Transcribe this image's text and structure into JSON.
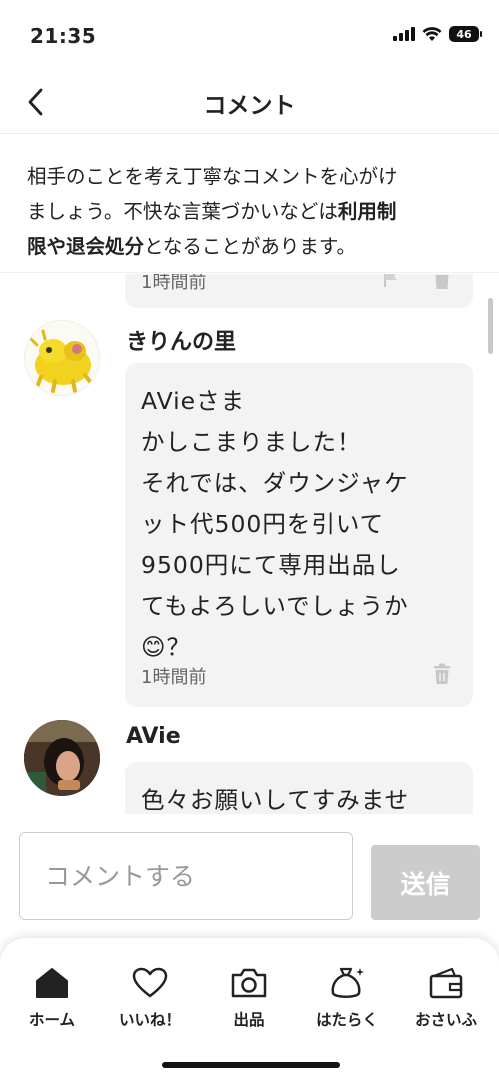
{
  "status_bar": {
    "time": "21:35",
    "battery": "46"
  },
  "header": {
    "title": "コメント"
  },
  "notice": {
    "line1": "相手のことを考え丁寧なコメントを心がけ",
    "line2": "ましょう。不快な言葉づかいなどは",
    "line2_bold": "利用制",
    "line3_bold": "限や退会処分",
    "line3": "となることがあります。"
  },
  "comments": [
    {
      "time": "1時間前"
    },
    {
      "username": "きりんの里",
      "text": "AVieさま\nかしこまりました！\nそれでは、ダウンジャケ\nット代500円を引いて\n9500円にて専用出品し\nてもよろしいでしょうか\n😊？",
      "time": "1時間前"
    },
    {
      "username": "AVie",
      "text": "色々お願いしてすみませ"
    }
  ],
  "input": {
    "placeholder": "コメントする",
    "send_label": "送信"
  },
  "bottom_nav": {
    "items": [
      {
        "label": "ホーム",
        "icon": "home-icon"
      },
      {
        "label": "いいね！",
        "icon": "heart-icon"
      },
      {
        "label": "出品",
        "icon": "camera-icon"
      },
      {
        "label": "はたらく",
        "icon": "money-bag-icon"
      },
      {
        "label": "おさいふ",
        "icon": "wallet-icon"
      }
    ]
  },
  "colors": {
    "bubble": "#f3f3f3",
    "send_disabled": "#cccccc",
    "text": "#222222",
    "muted": "#666666"
  }
}
